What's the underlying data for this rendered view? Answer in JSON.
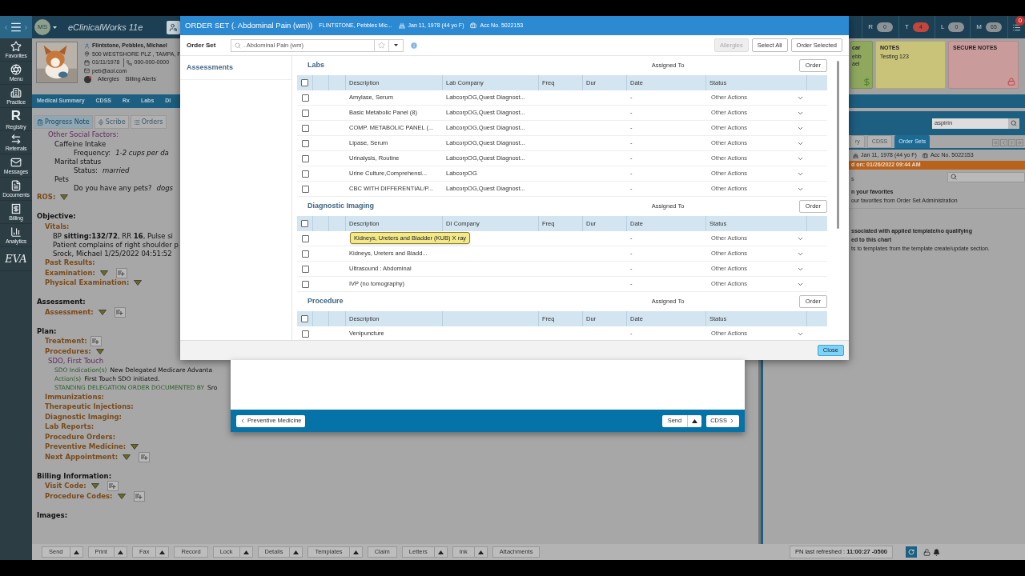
{
  "header": {
    "avatar": "MS",
    "app_title": "eClinicalWorks 11e",
    "counters": [
      {
        "label": "R",
        "count": "0",
        "alert": false
      },
      {
        "label": "T",
        "count": "4",
        "alert": true
      },
      {
        "label": "L",
        "count": "0",
        "alert": false
      },
      {
        "label": "M",
        "count": "65",
        "alert": false
      }
    ],
    "menu_badge": "0"
  },
  "nav": [
    {
      "kind": "icon",
      "label": "Favorites"
    },
    {
      "kind": "icon",
      "label": "Menu"
    },
    {
      "kind": "icon",
      "label": "Practice"
    },
    {
      "kind": "glyph",
      "glyph": "R",
      "label": "Registry"
    },
    {
      "kind": "icon",
      "label": "Referrals"
    },
    {
      "kind": "icon",
      "label": "Messages"
    },
    {
      "kind": "icon",
      "label": "Documents"
    },
    {
      "kind": "icon",
      "label": "Billing"
    },
    {
      "kind": "icon",
      "label": "Analytics"
    },
    {
      "kind": "logo",
      "text": "EVA"
    }
  ],
  "patient": {
    "name": "Flintstone, Pebbles, Michael",
    "address": "500 WESTSHORE PLZ , TAMPA, F",
    "dob": "01/11/1978",
    "phone": "000-000-0000",
    "email": "peb@aol.com",
    "alerts": [
      "Allergies",
      "Billing Alerts"
    ]
  },
  "chart_tabs": [
    "Medical Summary",
    "CDSS",
    "Rx",
    "Labs",
    "DI"
  ],
  "note_tabs": [
    {
      "label": "Progress Note",
      "selected": true
    },
    {
      "label": "Scribe",
      "selected": false
    },
    {
      "label": "Orders",
      "selected": false
    }
  ],
  "note": [
    {
      "kind": "group",
      "label": "Other Social Factors:",
      "children": [
        {
          "kind": "item",
          "text": "Caffeine Intake",
          "children": [
            {
              "kind": "field",
              "label": "Frequency:",
              "value": "1-2 cups per da"
            }
          ]
        },
        {
          "kind": "item",
          "text": "Marital status",
          "children": [
            {
              "kind": "field",
              "label": "Status:",
              "value": "married"
            }
          ]
        },
        {
          "kind": "item",
          "text": "Pets",
          "children": [
            {
              "kind": "field",
              "label": "Do you have any pets?",
              "value": "dogs"
            }
          ]
        }
      ]
    },
    {
      "kind": "label",
      "label": "ROS:",
      "dropdown": true,
      "add": false
    },
    {
      "kind": "heading",
      "label": "Objective:",
      "children": [
        {
          "kind": "label",
          "label": "Vitals:",
          "dropdown": false,
          "add": false,
          "children": [
            {
              "kind": "text",
              "text": "BP **sitting:132/72**, RR **16**, Pulse si"
            },
            {
              "kind": "text",
              "text": "Patient complains of right shoulder p"
            },
            {
              "kind": "text",
              "text": "Srock, Michael 1/25/2022 04:51:52"
            }
          ]
        },
        {
          "kind": "label",
          "label": "Past Results:",
          "dropdown": false,
          "add": false
        },
        {
          "kind": "label",
          "label": "Examination:",
          "dropdown": true,
          "add": true
        },
        {
          "kind": "label",
          "label": "Physical Examination:",
          "dropdown": true,
          "add": false
        }
      ]
    },
    {
      "kind": "heading",
      "label": "Assessment:",
      "children": [
        {
          "kind": "label",
          "label": "Assessment:",
          "dropdown": true,
          "add": true
        }
      ]
    },
    {
      "kind": "heading",
      "label": "Plan:",
      "children": [
        {
          "kind": "label",
          "label": "Treatment:",
          "dropdown": false,
          "add": true
        },
        {
          "kind": "label",
          "label": "Procedures:",
          "dropdown": true,
          "add": false,
          "children": [
            {
              "kind": "group",
              "label": "SDO, First Touch",
              "children": [
                {
                  "kind": "sdo",
                  "label": "SDO Indication(s)",
                  "value": "New Delegated Medicare Advanta"
                },
                {
                  "kind": "sdo",
                  "label": "Action(s)",
                  "value": "First Touch SDO initiated."
                },
                {
                  "kind": "sdo",
                  "label": "STANDING DELEGATION ORDER DOCUMENTED BY",
                  "value": "Sro"
                }
              ]
            }
          ]
        },
        {
          "kind": "label",
          "label": "Immunizations:",
          "dropdown": false,
          "add": false
        },
        {
          "kind": "label",
          "label": "Therapeutic Injections:",
          "dropdown": false,
          "add": false
        },
        {
          "kind": "label",
          "label": "Diagnostic Imaging:",
          "dropdown": false,
          "add": false
        },
        {
          "kind": "label",
          "label": "Lab Reports:",
          "dropdown": false,
          "add": false
        },
        {
          "kind": "label",
          "label": "Procedure Orders:",
          "dropdown": false,
          "add": false
        },
        {
          "kind": "label",
          "label": "Preventive Medicine:",
          "dropdown": true,
          "add": false
        },
        {
          "kind": "label",
          "label": "Next Appointment:",
          "dropdown": true,
          "add": true
        }
      ]
    },
    {
      "kind": "heading",
      "label": "Billing Information:",
      "children": [
        {
          "kind": "label",
          "label": "Visit Code:",
          "dropdown": true,
          "add": true
        },
        {
          "kind": "label",
          "label": "Procedure Codes:",
          "dropdown": true,
          "add": true
        }
      ]
    },
    {
      "kind": "heading",
      "label": "Images:"
    }
  ],
  "right": {
    "cards": [
      {
        "kind": "billing",
        "title": "car",
        "lines": [
          "ebb",
          "ael"
        ]
      },
      {
        "kind": "notes",
        "title": "NOTES",
        "lines": [
          "Testing 123"
        ]
      },
      {
        "kind": "secure",
        "title": "SECURE NOTES"
      }
    ],
    "search_value": "aspirin",
    "tabs": [
      {
        "label": "ry",
        "selected": false
      },
      {
        "label": "CDSS",
        "selected": false
      },
      {
        "label": "Order Sets",
        "selected": true
      }
    ],
    "dob": "Jan 11, 1978 (44 yo F)",
    "acc": "Acc No. 5022153",
    "banner": "d on: 01/26/2022 09:44 AM",
    "section_label": "s",
    "notices": [
      {
        "lines": [
          {
            "text": "n your favorites",
            "bold": true
          },
          {
            "text": "our favorites from Order Set Administration",
            "bold": false
          }
        ]
      },
      {
        "lines": [
          {
            "text": "ssociated with applied template/no qualifying",
            "bold": true
          },
          {
            "text": "ed to this chart",
            "bold": true
          },
          {
            "text": "ts to templates from the template create/update section.",
            "bold": false
          }
        ]
      }
    ]
  },
  "modal": {
    "title": "ORDER SET (. Abdominal Pain (wm))",
    "patient": "FLINTSTONE, Pebbles Mic...",
    "dob": "Jan 11, 1978 (44 yo F)",
    "acc": "Acc No. 5022153",
    "order_set_label": "Order Set",
    "search_value": ". Abdominal Pain (wm)",
    "buttons": [
      {
        "label": "Allergies",
        "disabled": true
      },
      {
        "label": "Select All",
        "disabled": false
      },
      {
        "label": "Order Selected",
        "disabled": false
      }
    ],
    "sidebar": [
      "Assessments"
    ],
    "sections": [
      {
        "title": "Labs",
        "all_checked": false,
        "assigned": "Assigned To",
        "order": "Order",
        "columns": [
          "Description",
          "Lab Company",
          "Freq",
          "Dur",
          "Date",
          "Status"
        ],
        "rows": [
          {
            "checked": false,
            "description": "Amylase, Serum",
            "company": "LabcorpOG,Quest Diagnost...",
            "date": "-",
            "status": "Other Actions"
          },
          {
            "checked": false,
            "description": "Basic Metabolic Panel (8)",
            "company": "LabcorpOG,Quest Diagnost...",
            "date": "-",
            "status": "Other Actions"
          },
          {
            "checked": false,
            "description": "COMP. METABOLIC PANEL (...",
            "company": "LabcorpOG,Quest Diagnost...",
            "date": "-",
            "status": "Other Actions"
          },
          {
            "checked": false,
            "description": "Lipase, Serum",
            "company": "LabcorpOG,Quest Diagnost...",
            "date": "-",
            "status": "Other Actions"
          },
          {
            "checked": false,
            "description": "Urinalysis, Routine",
            "company": "LabcorpOG,Quest Diagnost...",
            "date": "-",
            "status": "Other Actions"
          },
          {
            "checked": false,
            "description": "Urine Culture,Comprehensi...",
            "company": "LabcorpOG",
            "date": "-",
            "status": "Other Actions"
          },
          {
            "checked": false,
            "description": "CBC WITH DIFFERENTIAL/P...",
            "company": "LabcorpOG,Quest Diagnost...",
            "date": "-",
            "status": "Other Actions"
          }
        ]
      },
      {
        "title": "Diagnostic Imaging",
        "all_checked": false,
        "assigned": "Assigned To",
        "order": "Order",
        "columns": [
          "Description",
          "DI Company",
          "Freq",
          "Dur",
          "Date",
          "Status"
        ],
        "rows": [
          {
            "checked": false,
            "tooltip": "Kidneys, Ureters and Bladder (KUB) X ray",
            "date": "-",
            "status": "Other Actions"
          },
          {
            "checked": false,
            "description": "Kidneys, Ureters and Bladd...",
            "date": "-",
            "status": "Other Actions"
          },
          {
            "checked": false,
            "description": "Ultrasound : Abdominal",
            "date": "-",
            "status": "Other Actions"
          },
          {
            "checked": false,
            "description": "IVP (no tomography)",
            "date": "-",
            "status": "Other Actions"
          }
        ]
      },
      {
        "title": "Procedure",
        "all_checked": false,
        "assigned": "Assigned To",
        "order": "Order",
        "columns": [
          "Description",
          "",
          "Freq",
          "Dur",
          "Date",
          "Status"
        ],
        "rows": [
          {
            "checked": false,
            "description": "Venipuncture",
            "date": "-",
            "status": "Other Actions"
          }
        ]
      }
    ],
    "close": "Close"
  },
  "preventive": {
    "back": "Preventive Medicine",
    "send": "Send",
    "next": "CDSS"
  },
  "toolbar": {
    "buttons": [
      {
        "label": "Send",
        "menu": true
      },
      {
        "label": "Print",
        "menu": true
      },
      {
        "label": "Fax",
        "menu": true
      },
      {
        "label": "Record",
        "menu": false
      },
      {
        "label": "Lock",
        "menu": true
      },
      {
        "label": "Details",
        "menu": true
      },
      {
        "label": "Templates",
        "menu": true
      },
      {
        "label": "Claim",
        "menu": false
      },
      {
        "label": "Letters",
        "menu": true
      },
      {
        "label": "Ink",
        "menu": true
      },
      {
        "label": "Attachments",
        "menu": false
      }
    ],
    "refreshed": "PN last refreshed : **11:00:27 -0500**"
  }
}
